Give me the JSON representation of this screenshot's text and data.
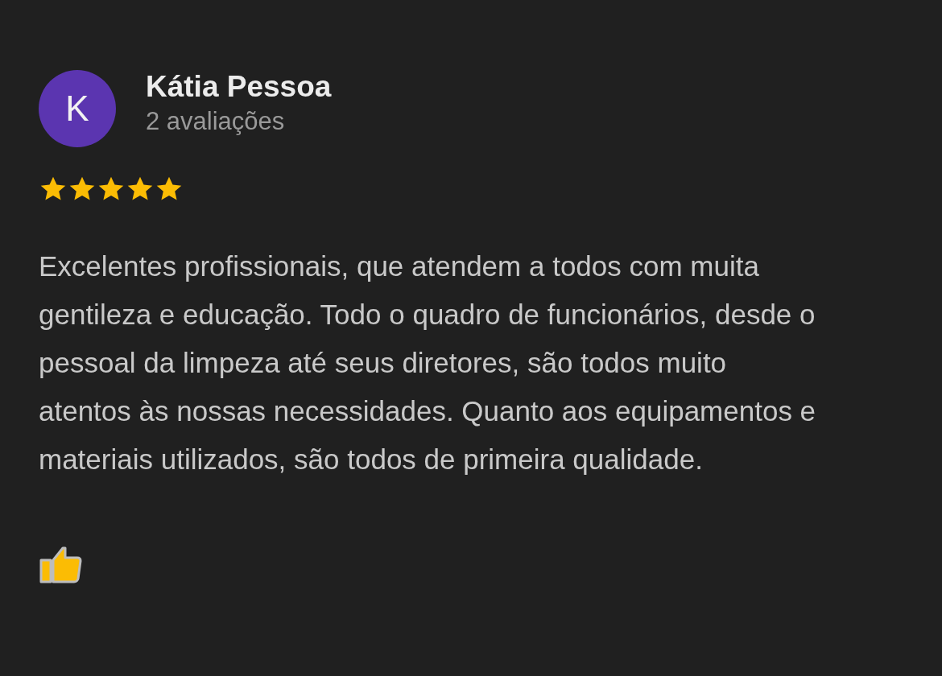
{
  "review": {
    "avatar_letter": "K",
    "author": "Kátia Pessoa",
    "review_count": "2 avaliações",
    "stars": 5,
    "text": "Excelentes profissionais, que atendem a todos com muita gentileza e educação. Todo o quadro de funcionários, desde o pessoal da limpeza até seus diretores, são todos muito atentos às nossas necessidades. Quanto aos equipamentos e materiais utilizados, são todos de primeira qualidade."
  }
}
